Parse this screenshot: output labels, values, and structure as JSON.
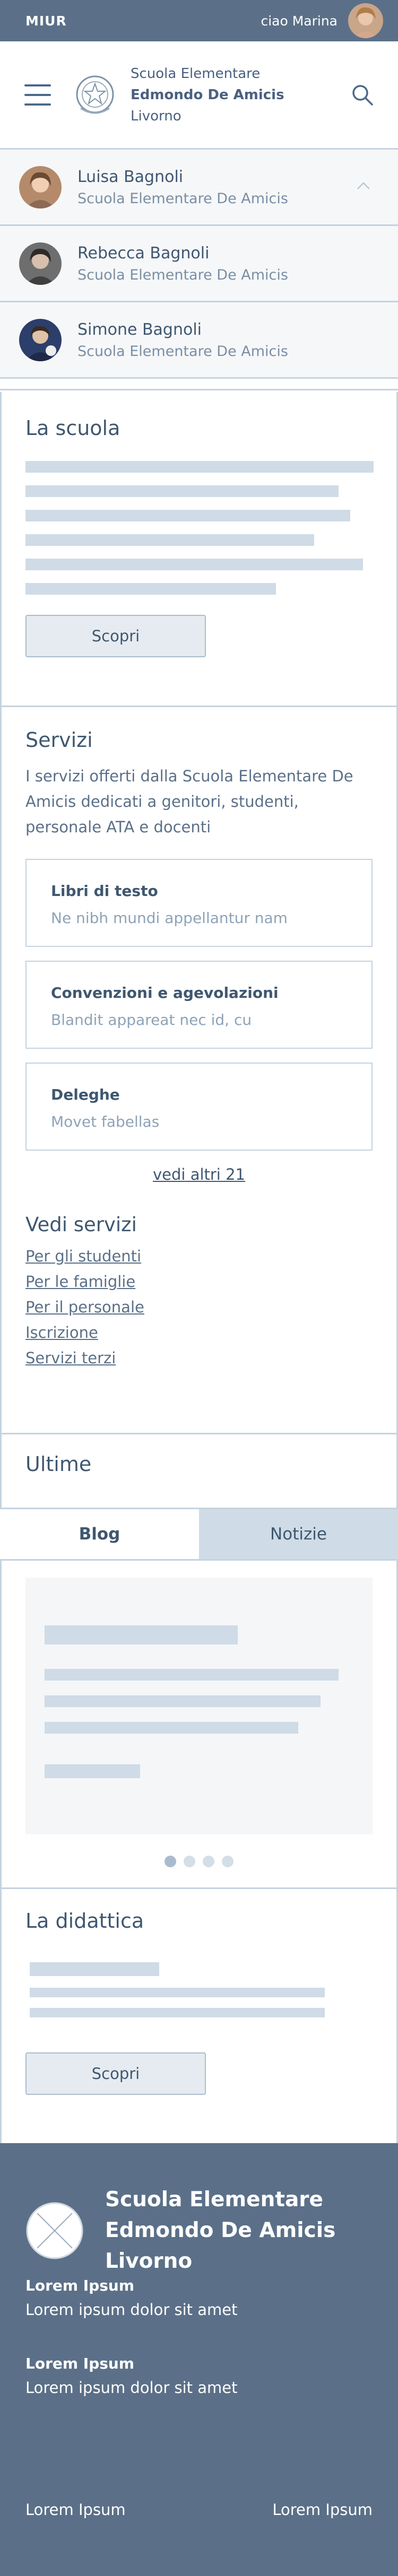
{
  "topbar": {
    "brand": "MIUR",
    "greeting": "ciao Marina"
  },
  "header": {
    "school_line1": "Scuola Elementare",
    "school_line2": "Edmondo De Amicis",
    "school_line3": "Livorno"
  },
  "profiles": [
    {
      "name": "Luisa Bagnoli",
      "school": "Scuola Elementare De Amicis"
    },
    {
      "name": "Rebecca Bagnoli",
      "school": "Scuola Elementare De Amicis"
    },
    {
      "name": "Simone Bagnoli",
      "school": "Scuola Elementare De Amicis"
    }
  ],
  "la_scuola": {
    "title": "La scuola",
    "button": "Scopri"
  },
  "servizi": {
    "title": "Servizi",
    "description": "I servizi offerti dalla Scuola Elementare De Amicis dedicati a genitori, studenti, personale ATA e docenti",
    "cards": [
      {
        "title": "Libri di testo",
        "text": "Ne nibh mundi appellantur nam"
      },
      {
        "title": "Convenzioni e agevolazioni",
        "text": "Blandit appareat nec id, cu"
      },
      {
        "title": "Deleghe",
        "text": "Movet fabellas"
      }
    ],
    "more_link": "vedi altri 21",
    "vedi_title": "Vedi servizi",
    "vedi_links": [
      "Per gli studenti",
      "Per le famiglie",
      "Per il personale",
      "Iscrizione",
      "Servizi terzi"
    ]
  },
  "ultime": {
    "title": "Ultime",
    "tabs": [
      "Blog",
      "Notizie"
    ]
  },
  "didattica": {
    "title": "La didattica",
    "button": "Scopri"
  },
  "footer": {
    "school_line1": "Scuola Elementare",
    "school_line2": "Edmondo De Amicis",
    "school_line3": "Livorno",
    "blocks": [
      {
        "label": "Lorem Ipsum",
        "text": "Lorem ipsum dolor sit amet"
      },
      {
        "label": "Lorem Ipsum",
        "text": "Lorem ipsum dolor sit amet"
      }
    ],
    "bottom_left": "Lorem Ipsum",
    "bottom_right": "Lorem Ipsum"
  },
  "colors": {
    "primary": "#5b7088",
    "border": "#c5d3df",
    "skeleton": "#cfdbe6",
    "text": "#3f5770"
  }
}
